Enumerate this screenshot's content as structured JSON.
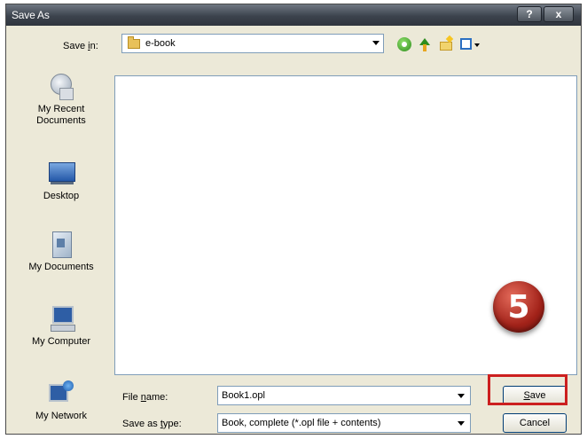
{
  "window": {
    "title": "Save As",
    "help_label": "?",
    "close_label": "x"
  },
  "toolbar": {
    "save_in_label_pre": "Save ",
    "save_in_label_ul": "i",
    "save_in_label_post": "n:",
    "save_in_value": "e-book",
    "icons": [
      "back-icon",
      "up-folder-icon",
      "new-folder-icon",
      "views-menu-icon"
    ]
  },
  "places": [
    {
      "name": "my-recent-documents",
      "label_line1": "My Recent",
      "label_line2": "Documents"
    },
    {
      "name": "desktop",
      "label_line1": "Desktop",
      "label_line2": ""
    },
    {
      "name": "my-documents",
      "label_line1": "My Documents",
      "label_line2": ""
    },
    {
      "name": "my-computer",
      "label_line1": "My Computer",
      "label_line2": ""
    },
    {
      "name": "my-network",
      "label_line1": "My Network",
      "label_line2": ""
    }
  ],
  "file_name": {
    "label_pre": "File ",
    "label_ul": "n",
    "label_post": "ame:",
    "value": "Book1.opl"
  },
  "save_as_type": {
    "label_pre": "Save as ",
    "label_ul": "t",
    "label_post": "ype:",
    "value": "Book, complete (*.opl file + contents)"
  },
  "buttons": {
    "save_ul": "S",
    "save_rest": "ave",
    "cancel": "Cancel"
  },
  "annotation": {
    "step_number": "5",
    "highlight_color": "#cc1f1f",
    "badge_color": "#a3231a"
  }
}
